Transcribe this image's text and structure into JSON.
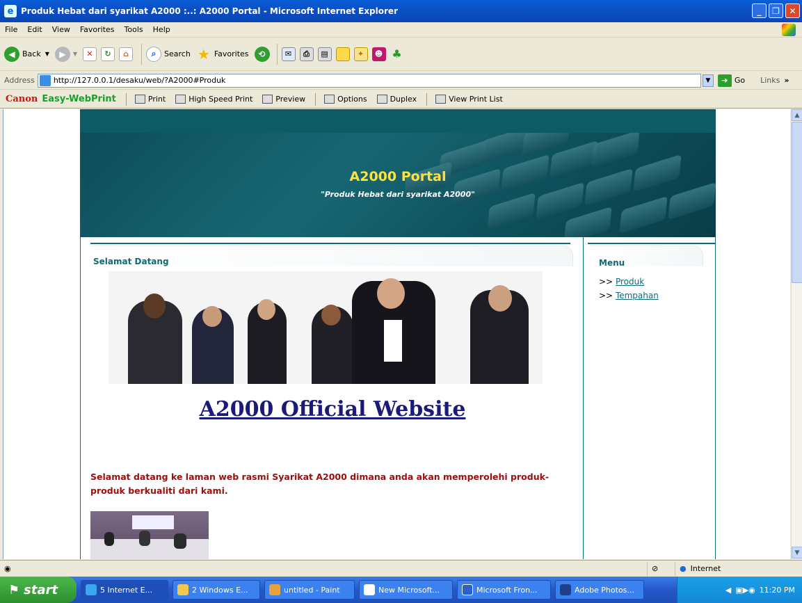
{
  "window": {
    "title": "Produk Hebat dari syarikat A2000 :..: A2000 Portal - Microsoft Internet Explorer"
  },
  "menubar": [
    "File",
    "Edit",
    "View",
    "Favorites",
    "Tools",
    "Help"
  ],
  "toolbar": {
    "back": "Back",
    "search": "Search",
    "favorites": "Favorites"
  },
  "address": {
    "label": "Address",
    "url": "http://127.0.0.1/desaku/web/?A2000#Produk",
    "go": "Go",
    "links": "Links"
  },
  "canonbar": {
    "brand": "Canon",
    "product": "Easy-WebPrint",
    "print": "Print",
    "high_speed": "High Speed Print",
    "preview": "Preview",
    "options": "Options",
    "duplex": "Duplex",
    "view_list": "View Print List"
  },
  "page": {
    "banner_title": "A2000 Portal",
    "banner_subtitle": "\"Produk Hebat dari syarikat A2000\"",
    "section_heading": "Selamat Datang",
    "official_link": "A2000 Official Website",
    "welcome_text": "Selamat datang ke laman web rasmi Syarikat A2000 dimana anda akan memperolehi produk-produk berkualiti dari kami.",
    "menu_heading": "Menu",
    "menu_prefix": ">>",
    "menu_items": [
      "Produk",
      "Tempahan"
    ]
  },
  "status": {
    "zone": "Internet"
  },
  "taskbar": {
    "start": "start",
    "tasks": [
      "5 Internet E...",
      "2 Windows E...",
      "untitled - Paint",
      "New Microsoft...",
      "Microsoft Fron...",
      "Adobe Photos..."
    ],
    "clock": "11:20 PM"
  }
}
